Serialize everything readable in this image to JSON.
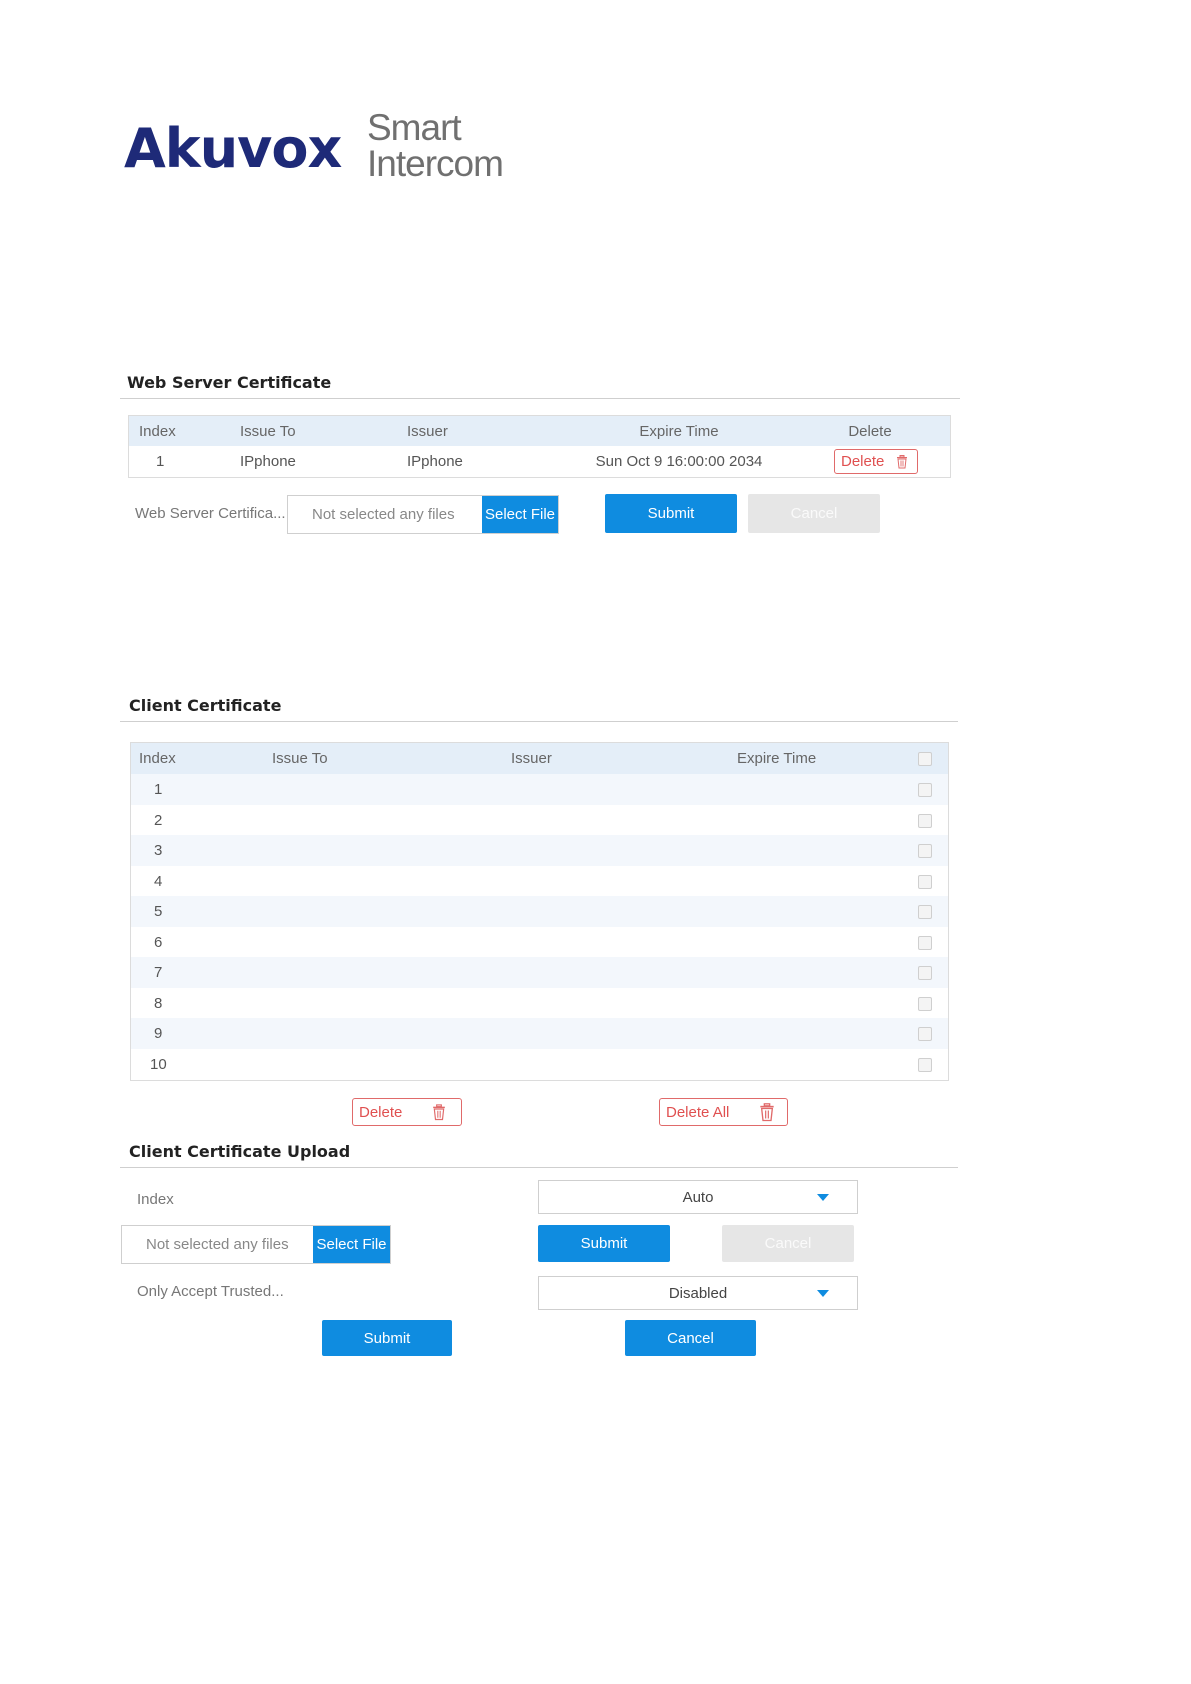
{
  "logo": {
    "brand": "Akuvox",
    "line1": "Smart",
    "line2": "Intercom"
  },
  "web_server": {
    "title": "Web Server Certificate",
    "columns": [
      "Index",
      "Issue To",
      "Issuer",
      "Expire Time",
      "Delete"
    ],
    "row": {
      "index": "1",
      "issue_to": "IPphone",
      "issuer": "IPphone",
      "expire": "Sun Oct 9 16:00:00 2034",
      "delete_label": "Delete"
    },
    "upload_label": "Web Server Certifica...",
    "file_placeholder": "Not selected any files",
    "select_file": "Select File",
    "submit": "Submit",
    "cancel": "Cancel"
  },
  "client": {
    "title": "Client Certificate",
    "columns": [
      "Index",
      "Issue To",
      "Issuer",
      "Expire Time"
    ],
    "rows": [
      "1",
      "2",
      "3",
      "4",
      "5",
      "6",
      "7",
      "8",
      "9",
      "10"
    ],
    "delete": "Delete",
    "delete_all": "Delete All"
  },
  "upload": {
    "title": "Client Certificate Upload",
    "index_label": "Index",
    "index_value": "Auto",
    "file_placeholder": "Not selected any files",
    "select_file": "Select File",
    "submit": "Submit",
    "cancel": "Cancel",
    "trusted_label": "Only Accept Trusted...",
    "trusted_value": "Disabled",
    "submit2": "Submit",
    "cancel2": "Cancel"
  },
  "colors": {
    "accent": "#0f8ce0",
    "danger": "#e05050",
    "header_bg": "#e4eef8",
    "brand": "#1e2a78"
  }
}
